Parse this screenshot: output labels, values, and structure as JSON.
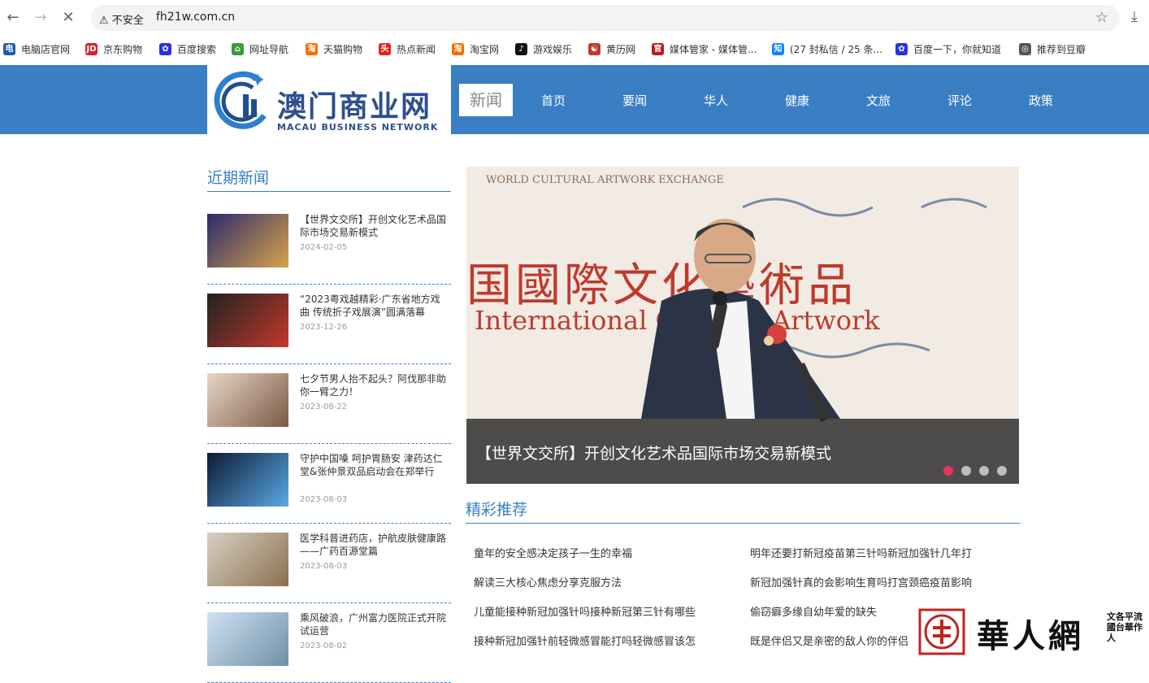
{
  "browser": {
    "back_icon": "arrow-left",
    "forward_icon": "arrow-right",
    "stop_icon": "close",
    "security_label": "不安全",
    "url": "fh21w.com.cn",
    "bookmarks": [
      {
        "label": "电脑店官网",
        "icon": "电",
        "color": "#1e5aa8"
      },
      {
        "label": "京东购物",
        "icon": "JD",
        "color": "#d8232a"
      },
      {
        "label": "百度搜索",
        "icon": "✿",
        "color": "#2932e1"
      },
      {
        "label": "网址导航",
        "icon": "⌂",
        "color": "#3a9b3a"
      },
      {
        "label": "天猫购物",
        "icon": "淘",
        "color": "#ff6a00"
      },
      {
        "label": "热点新闻",
        "icon": "头",
        "color": "#e2231a"
      },
      {
        "label": "淘宝网",
        "icon": "淘",
        "color": "#ff6a00"
      },
      {
        "label": "游戏娱乐",
        "icon": "♪",
        "color": "#111111"
      },
      {
        "label": "黄历网",
        "icon": "☯",
        "color": "#c0392b"
      },
      {
        "label": "媒体管家 - 媒体管...",
        "icon": "官",
        "color": "#b71c1c"
      },
      {
        "label": "(27 封私信 / 25 条...",
        "icon": "知",
        "color": "#0a84ff"
      },
      {
        "label": "百度一下，你就知道",
        "icon": "✿",
        "color": "#2932e1"
      },
      {
        "label": "推荐到豆瓣",
        "icon": "◎",
        "color": "#555555"
      }
    ]
  },
  "header": {
    "logo_cn": "澳门商业网",
    "logo_en": "MACAU BUSINESS NETWORK",
    "nav_active": "新闻",
    "nav": [
      "首页",
      "要闻",
      "华人",
      "健康",
      "文旅",
      "评论",
      "政策"
    ]
  },
  "sidebar": {
    "title": "近期新闻",
    "items": [
      {
        "title": "【世界文交所】开创文化艺术品国际市场交易新模式",
        "date": "2024-02-05"
      },
      {
        "title": "“2023粤戏越精彩·广东省地方戏曲 传统折子戏展演”圆满落幕",
        "date": "2023-12-26"
      },
      {
        "title": "七夕节男人抬不起头？阿伐那非助你一臂之力！",
        "date": "2023-08-22"
      },
      {
        "title": "守护中国嗓 呵护胃肠安 津药达仁堂&张仲景双品启动会在郑举行",
        "date": "2023-08-03"
      },
      {
        "title": "医学科普进药店，护航皮肤健康路——广药百源堂篇",
        "date": "2023-08-03"
      },
      {
        "title": "乘风破浪，广州富力医院正式开院试运营",
        "date": "2023-08-02"
      }
    ]
  },
  "hero": {
    "caption": "【世界文交所】开创文化艺术品国际市场交易新模式",
    "banner_en": "WORLD CULTURAL ARTWORK EXCHANGE",
    "banner_cn": "国國際文化藝術品",
    "banner_en2": "International Cultural Artwork",
    "slides": 4,
    "active_slide": 1
  },
  "recommended": {
    "title": "精彩推荐",
    "left": [
      "童年的安全感决定孩子一生的幸福",
      "解读三大核心焦虑分享克服方法",
      "儿童能接种新冠加强针吗接种新冠第三针有哪些",
      "接种新冠加强针前轻微感冒能打吗轻微感冒该怎"
    ],
    "right": [
      "明年还要打新冠疫苗第三针吗新冠加强针几年打",
      "新冠加强针真的会影响生育吗打宫颈癌疫苗影响",
      "偷窃癖多缘自幼年爱的缺失",
      "既是伴侣又是亲密的敌人你的伴侣"
    ]
  },
  "watermark": {
    "text": "華人網",
    "side": "文各平流國台華作人"
  },
  "colors": {
    "brand": "#3a7ec4",
    "accent": "#e8355b"
  }
}
